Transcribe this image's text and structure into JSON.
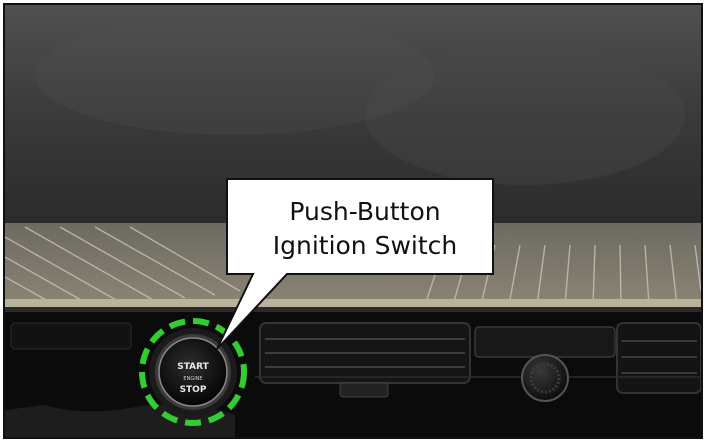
{
  "callout": {
    "line1": "Push-Button",
    "line2": "Ignition Switch"
  },
  "button_text": {
    "start": "START",
    "engine": "ENGINE",
    "stop": "STOP"
  },
  "colors": {
    "highlight_ring": "#33cc33",
    "callout_fill": "#ffffff",
    "callout_border": "#111111",
    "frame_border": "#111111"
  },
  "icons": {
    "highlight": "dashed-circle",
    "pointer": "speech-bubble-tail"
  }
}
